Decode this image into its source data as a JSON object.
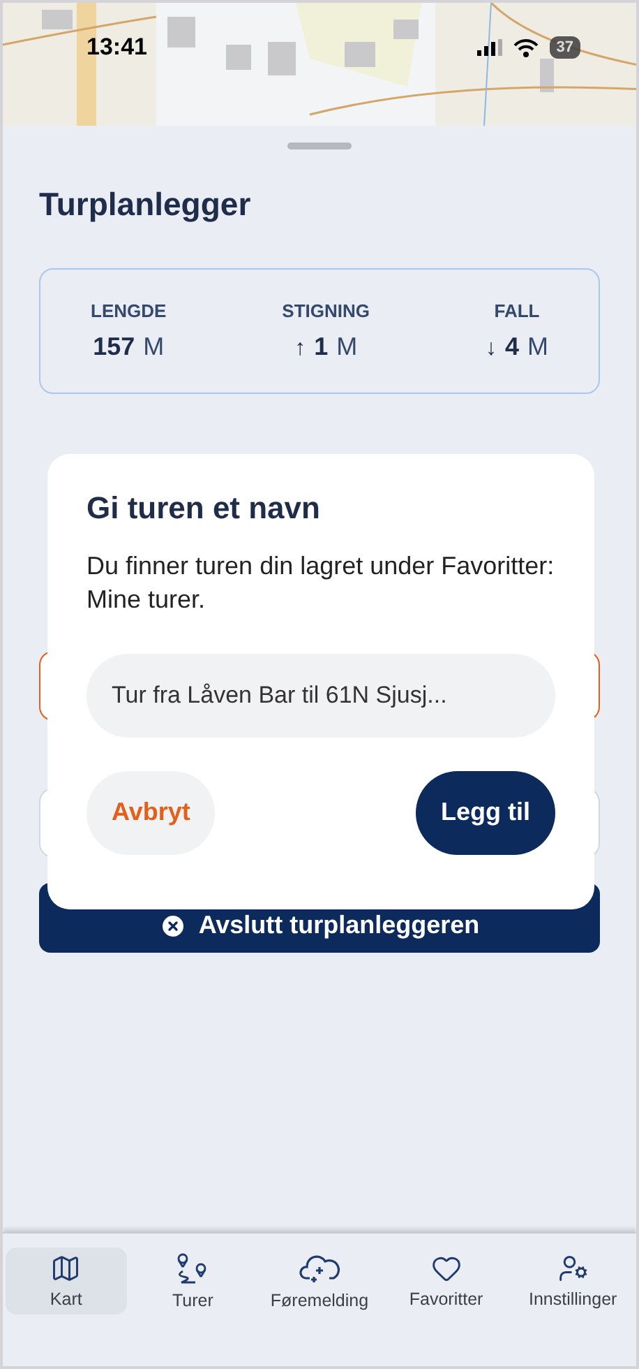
{
  "status_bar": {
    "time": "13:41",
    "battery": "37"
  },
  "title": "Turplanlegger",
  "stats": [
    {
      "label": "LENGDE",
      "value": "157",
      "unit": "M"
    },
    {
      "label": "STIGNING",
      "arrow": "↑",
      "value": "1",
      "unit": "M"
    },
    {
      "label": "FALL",
      "arrow": "↓",
      "value": "4",
      "unit": "M"
    }
  ],
  "dialog": {
    "title": "Gi turen et navn",
    "message": "Du finner turen din lagret under Favoritter: Mine turer.",
    "input": {
      "value": "Tur fra Låven Bar til 61N Sjusj..."
    },
    "buttons": [
      {
        "label": "Avbryt",
        "kind": "secondary"
      },
      {
        "label": "Legg til",
        "kind": "primary"
      }
    ]
  },
  "end_button": {
    "label": "Avslutt turplanleggeren"
  },
  "nav": [
    {
      "label": "Kart",
      "kind": "map",
      "selected": true
    },
    {
      "label": "Turer",
      "kind": "route",
      "selected": false
    },
    {
      "label": "Føremelding",
      "kind": "cloud",
      "selected": false
    },
    {
      "label": "Favoritter",
      "kind": "heart",
      "selected": false
    },
    {
      "label": "Innstillinger",
      "kind": "user",
      "selected": false
    }
  ]
}
